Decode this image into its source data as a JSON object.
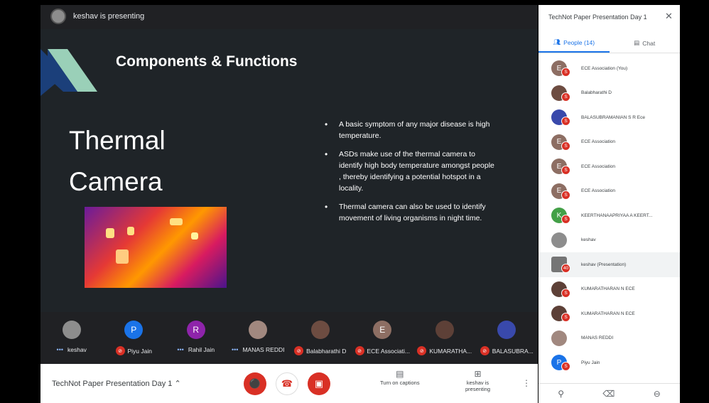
{
  "presenter_bar": {
    "text": "keshav is presenting"
  },
  "slide": {
    "title": "Components & Functions",
    "heading_line1": "Thermal",
    "heading_line2": "Camera",
    "bullets": [
      "A basic symptom of any major disease is high temperature.",
      "ASDs make use of the thermal camera to identify high body temperature amongst people , thereby identifying a potential hotspot in a locality.",
      "Thermal camera can also be used to identify movement of living organisms in night time."
    ]
  },
  "filmstrip": [
    {
      "name": "keshav",
      "initial": "",
      "color": "#8d8d8d",
      "muted": false
    },
    {
      "name": "Piyu Jain",
      "initial": "P",
      "color": "#1a73e8",
      "muted": true
    },
    {
      "name": "Rahil Jain",
      "initial": "R",
      "color": "#8e24aa",
      "muted": false
    },
    {
      "name": "MANAS REDDI",
      "initial": "",
      "color": "#a1887f",
      "muted": false
    },
    {
      "name": "Balabharathi D",
      "initial": "",
      "color": "#6d4c41",
      "muted": true
    },
    {
      "name": "ECE Associati...",
      "initial": "E",
      "color": "#8d6e63",
      "muted": true
    },
    {
      "name": "KUMARATHA...",
      "initial": "",
      "color": "#5d4037",
      "muted": true
    },
    {
      "name": "BALASUBRA...",
      "initial": "",
      "color": "#3949ab",
      "muted": true
    }
  ],
  "bottom_bar": {
    "meeting_title": "TechNot Paper Presentation Day 1",
    "captions_label": "Turn on captions",
    "presenting_label": "keshav is presenting"
  },
  "side_panel": {
    "title": "TechNot Paper Presentation Day 1",
    "tab_people": "People (14)",
    "tab_chat": "Chat",
    "participants": [
      {
        "name": "ECE Association (You)",
        "initial": "E",
        "color": "#8d6e63",
        "badge": "S"
      },
      {
        "name": "Balabharathi D",
        "initial": "",
        "color": "#6d4c41",
        "badge": "S"
      },
      {
        "name": "BALASUBRAMANIAN S R Ece",
        "initial": "",
        "color": "#3949ab",
        "badge": "S"
      },
      {
        "name": "ECE Association",
        "initial": "E",
        "color": "#8d6e63",
        "badge": "S"
      },
      {
        "name": "ECE Association",
        "initial": "E",
        "color": "#8d6e63",
        "badge": "S"
      },
      {
        "name": "ECE Association",
        "initial": "E",
        "color": "#8d6e63",
        "badge": "S"
      },
      {
        "name": "KEERTHANAAPRIYAA A KEERT...",
        "initial": "K",
        "color": "#43a047",
        "badge": "S"
      },
      {
        "name": "keshav",
        "initial": "",
        "color": "#8d8d8d",
        "badge": ""
      },
      {
        "name": "keshav (Presentation)",
        "initial": "",
        "color": "#757575",
        "badge": "40"
      },
      {
        "name": "KUMARATHARAN N ECE",
        "initial": "",
        "color": "#5d4037",
        "badge": "S"
      },
      {
        "name": "KUMARATHARAN N ECE",
        "initial": "",
        "color": "#5d4037",
        "badge": "S"
      },
      {
        "name": "MANAS REDDI",
        "initial": "",
        "color": "#a1887f",
        "badge": ""
      },
      {
        "name": "Piyu Jain",
        "initial": "P",
        "color": "#1a73e8",
        "badge": "S"
      }
    ]
  }
}
